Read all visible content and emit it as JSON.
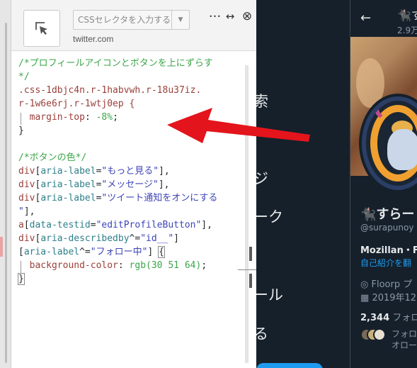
{
  "twitter": {
    "nav_fragments": [
      "索",
      "ジ",
      "ーク",
      "ール",
      "る"
    ],
    "back_glyph": "←",
    "header_name": "🐈‍⬛す",
    "header_post_count": "2.9万",
    "profile_name": "🐈‍⬛すらー",
    "profile_handle": "@surapunoy",
    "bio": "Mozillan・Fi",
    "translate_link": "自己紹介を翻",
    "location": "Floorp プ",
    "joined": "2019年12",
    "follow_count": "2,344",
    "follow_label": " フォロ",
    "follower_note_line1": "フォロ",
    "follower_note_line2": "オロー"
  },
  "panel": {
    "selector_placeholder": "CSSセレクタを入力する...",
    "site": "twitter.com",
    "icons": [
      "more-icon",
      "resize-icon",
      "close-icon"
    ],
    "more_glyph": "•••",
    "resize_glyph": "↔",
    "close_glyph": "⊗"
  },
  "code": {
    "c1": "/*プロフィールアイコンとボタンを上にずらす",
    "c1b": "*/",
    "s1": ".css-1dbjc4n.r-1habvwh.r-18u37iz.",
    "s2": "r-1w6e6rj.r-1wtj0ep {",
    "p1": "margin-top",
    "colon": ": ",
    "v1": "-8%",
    "semi": ";",
    "close_brace": "}",
    "c2": "/*ボタンの色*/",
    "el_div": "div",
    "el_a": "a",
    "lb": "[",
    "rb": "]",
    "comma": ",",
    "eq": "=",
    "caret_eq": "^=",
    "attr_aria_label": "aria-label",
    "attr_testid": "data-testid",
    "attr_describedby": "aria-describedby",
    "str_more": "\"もっと見る\"",
    "str_message": "\"メッセージ\"",
    "str_notify": "\"ツイート通知をオンにする",
    "str_notify_end": "\"",
    "str_edit": "\"editProfileButton\"",
    "str_id": "\"id__\"",
    "str_follow": "\"フォロー中\"",
    "open_brace": "{",
    "p2": "background-color",
    "v2_fn": "rgb",
    "v2_args": "(30 51 64)"
  },
  "colors": {
    "twitter_bg": "#15202b",
    "accent_red": "#e3141b",
    "twitter_blue": "#1d9bf0"
  }
}
